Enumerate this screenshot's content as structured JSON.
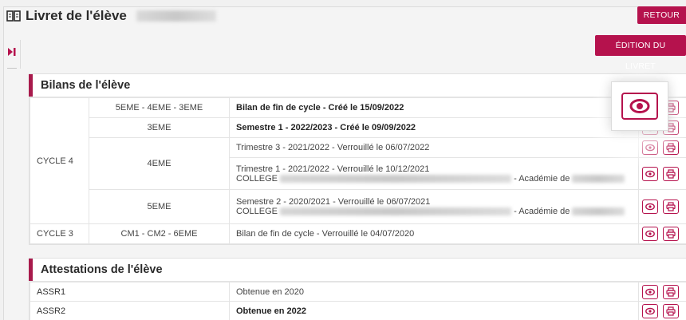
{
  "header": {
    "title": "Livret de l'élève",
    "retour_label": "RETOUR",
    "edition_label": "ÉDITION DU LIVRET"
  },
  "bilans": {
    "title": "Bilans de l'élève",
    "rows": [
      {
        "cycle": "CYCLE 4",
        "levels": "5EME - 4EME - 3EME",
        "text": "Bilan de fin de cycle - Créé le 15/09/2022",
        "bold": true
      },
      {
        "levels": "3EME",
        "text": "Semestre 1 - 2022/2023 - Créé le 09/09/2022",
        "bold": true
      },
      {
        "levels": "4EME",
        "text": "Trimestre 3 - 2021/2022 - Verrouillé le 06/07/2022"
      },
      {
        "text": "Trimestre 1 - 2021/2022 - Verrouillé le 10/12/2021",
        "line2_prefix": "COLLEGE",
        "line2_suffix": "- Académie de"
      },
      {
        "levels": "5EME",
        "text": "Semestre 2 - 2020/2021 - Verrouillé le 06/07/2021",
        "line2_prefix": "COLLEGE",
        "line2_suffix": "- Académie de"
      },
      {
        "cycle": "CYCLE 3",
        "levels": "CM1 - CM2 - 6EME",
        "text": "Bilan de fin de cycle - Verrouillé le 04/07/2020"
      }
    ]
  },
  "attestations": {
    "title": "Attestations de l'élève",
    "rows": [
      {
        "name": "ASSR1",
        "text": "Obtenue en 2020"
      },
      {
        "name": "ASSR2",
        "text": "Obtenue en 2022",
        "bold": true
      }
    ]
  },
  "icons": {
    "view": "eye-icon",
    "print": "printer-icon",
    "title": "book-icon",
    "toggle": "skip-forward-icon"
  },
  "colors": {
    "accent": "#b5124d",
    "section_bar": "#a81a4c"
  }
}
